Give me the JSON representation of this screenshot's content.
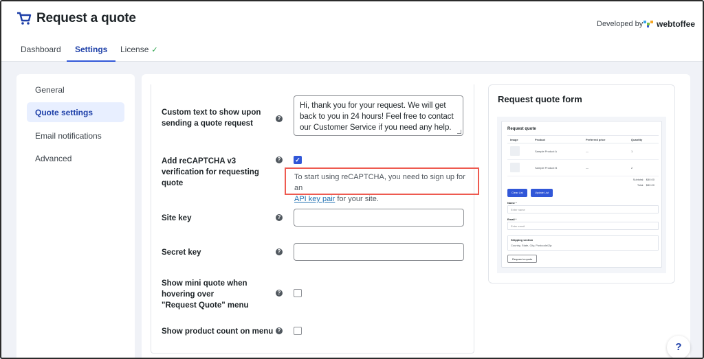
{
  "app": {
    "title": "Request a quote",
    "icon": "cart-icon",
    "developed_by": "Developed by",
    "brand_name": "webtoffee"
  },
  "tabs": [
    {
      "label": "Dashboard",
      "active": false
    },
    {
      "label": "Settings",
      "active": true
    },
    {
      "label": "License",
      "active": false,
      "badge": "✓"
    }
  ],
  "sidebar": {
    "items": [
      {
        "label": "General",
        "active": false
      },
      {
        "label": "Quote settings",
        "active": true
      },
      {
        "label": "Email notifications",
        "active": false
      },
      {
        "label": "Advanced",
        "active": false
      }
    ]
  },
  "settings": {
    "custom_text": {
      "label": "Custom text to show upon sending a quote request",
      "value": "Hi, thank you for your request. We will get back to you in 24 hours! Feel free to contact our Customer Service if you need any help."
    },
    "recaptcha": {
      "label": "Add reCAPTCHA v3 verification for requesting quote",
      "checked": true,
      "note_before": "To start using reCAPTCHA, you need to sign up for an",
      "note_link": "API key pair",
      "note_after": " for your site."
    },
    "site_key": {
      "label": "Site key",
      "value": ""
    },
    "secret_key": {
      "label": "Secret key",
      "value": ""
    },
    "mini_quote": {
      "label": "Show mini quote when hovering over \"Request Quote\" menu",
      "checked": false
    },
    "product_count": {
      "label": "Show product count on menu",
      "checked": false
    }
  },
  "preview": {
    "title": "Request quote form",
    "form_title": "Request quote",
    "columns": [
      "Image",
      "Product",
      "Preferred price",
      "Quantity"
    ],
    "rows": [
      {
        "product": "Sample Product A",
        "price": "—",
        "qty": "1"
      },
      {
        "product": "Sample Product B",
        "price": "—",
        "qty": "2"
      }
    ],
    "subtotal_label": "Subtotal:",
    "subtotal_value": "$80.00",
    "total_label": "Total:",
    "total_value": "$80.00",
    "clear_button": "Clear List",
    "update_button": "Update List",
    "name_label": "Name *",
    "name_placeholder": "Enter name",
    "email_label": "Email *",
    "email_placeholder": "Enter email",
    "shipping_label": "Shipping section",
    "shipping_text": "Country, State, City, Postcode/Zip",
    "submit_button": "Request a quote"
  },
  "help_button": "?",
  "colors": {
    "accent": "#3157d8",
    "active_tab": "#1d3fa8",
    "highlight_border": "#ee5a50",
    "success": "#2aa34a"
  }
}
